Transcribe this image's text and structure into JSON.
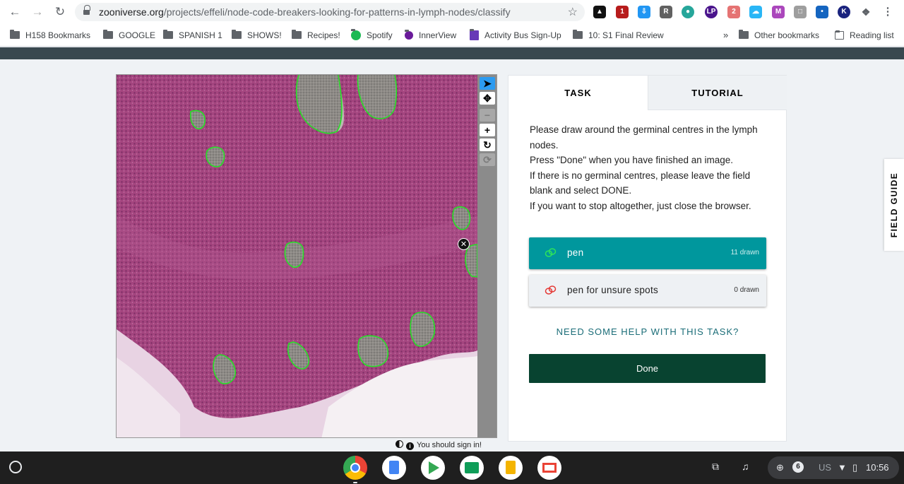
{
  "browser": {
    "url_domain": "zooniverse.org",
    "url_path": "/projects/effeli/node-code-breakers-looking-for-patterns-in-lymph-nodes/classify",
    "bookmarks": [
      {
        "label": "H158 Bookmarks",
        "icon": "bookmarks-icon"
      },
      {
        "label": "GOOGLE",
        "icon": "folder-icon"
      },
      {
        "label": "SPANISH 1",
        "icon": "folder-icon"
      },
      {
        "label": "SHOWS!",
        "icon": "folder-icon"
      },
      {
        "label": "Recipes!",
        "icon": "folder-icon"
      },
      {
        "label": "Spotify",
        "icon": "spotify-icon"
      },
      {
        "label": "InnerView",
        "icon": "innerview-icon"
      },
      {
        "label": "Activity Bus Sign-Up",
        "icon": "forms-icon"
      },
      {
        "label": "10: S1 Final Review",
        "icon": "folder-icon"
      }
    ],
    "overflow": "»",
    "other_bookmarks": "Other bookmarks",
    "reading_list": "Reading list",
    "ext_badge_1": "1",
    "ext_badge_2": "2",
    "ext_letter_r": "R",
    "ext_letter_k": "K"
  },
  "viewer": {
    "tools": [
      "select-arrow",
      "move",
      "zoom-out",
      "zoom-in",
      "rotate",
      "reset"
    ],
    "sign_in": "You should sign in!"
  },
  "task": {
    "tabs": [
      "TASK",
      "TUTORIAL"
    ],
    "instructions": [
      "Please draw around the germinal centres in the lymph nodes.",
      "Press \"Done\" when you have finished an image.",
      "If there is no germinal centres, please leave the field blank and select DONE.",
      "If you want to stop altogether, just close the browser."
    ],
    "tools": [
      {
        "label": "pen",
        "count": "11 drawn",
        "color": "#00b050",
        "selected": true
      },
      {
        "label": "pen for unsure spots",
        "count": "0 drawn",
        "color": "#e53935",
        "selected": false
      }
    ],
    "help": "NEED SOME HELP WITH THIS TASK?",
    "done": "Done"
  },
  "field_guide": "FIELD GUIDE",
  "shelf": {
    "apps": [
      "chrome",
      "docs",
      "play-store",
      "classroom",
      "slides",
      "gmail"
    ],
    "notification_count": "6",
    "ime": "US",
    "time": "10:56"
  },
  "colors": {
    "teal": "#00979d",
    "done_green": "#084330",
    "link_teal": "#1b6d78",
    "tissue": "#a24a83",
    "outline": "#27e027"
  }
}
